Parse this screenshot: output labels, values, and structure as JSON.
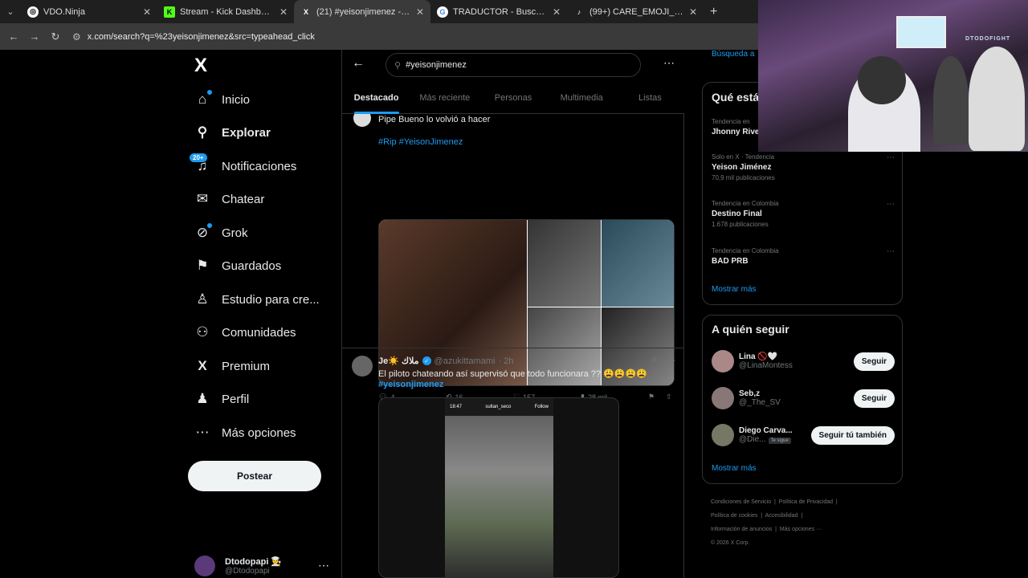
{
  "browser": {
    "tabs": [
      {
        "title": "VDO.Ninja",
        "fav_color": "#ffffff",
        "fav_text": "◎"
      },
      {
        "title": "Stream - Kick Dashboard",
        "fav_color": "#53fc18",
        "fav_text": "K"
      },
      {
        "title": "(21) #yeisonjimenez - Buscar / X",
        "fav_color": "#000000",
        "fav_text": "X"
      },
      {
        "title": "TRADUCTOR - Buscar con Goog",
        "fav_color": "#ffffff",
        "fav_text": "G"
      },
      {
        "title": "(99+) CARE_EMOJI_CLIPS. (@car",
        "fav_color": "#000000",
        "fav_text": "♪"
      }
    ],
    "url": "x.com/search?q=%23yeisonjimenez&src=typeahead_click"
  },
  "nav": {
    "logo": "X",
    "items": [
      {
        "label": "Inicio",
        "icon": "home-icon",
        "glyph": "⌂"
      },
      {
        "label": "Explorar",
        "icon": "search-icon",
        "glyph": "⚲"
      },
      {
        "label": "Notificaciones",
        "icon": "bell-icon",
        "glyph": "🔔"
      },
      {
        "label": "Chatear",
        "icon": "mail-icon",
        "glyph": "✉"
      },
      {
        "label": "Grok",
        "icon": "grok-icon",
        "glyph": "⊘"
      },
      {
        "label": "Guardados",
        "icon": "bookmark-icon",
        "glyph": "⚑"
      },
      {
        "label": "Estudio para cre...",
        "icon": "studio-icon",
        "glyph": "♙"
      },
      {
        "label": "Comunidades",
        "icon": "communities-icon",
        "glyph": "⚇"
      },
      {
        "label": "Premium",
        "icon": "premium-icon",
        "glyph": "X"
      },
      {
        "label": "Perfil",
        "icon": "profile-icon",
        "glyph": "♟"
      },
      {
        "label": "Más opciones",
        "icon": "more-icon",
        "glyph": "⋯"
      }
    ],
    "notif_badge": "20+",
    "post_label": "Postear",
    "account_name": "Dtodopapi 👨‍🍳",
    "account_handle": "@Dtodopapi"
  },
  "search": {
    "query": "#yeisonjimenez",
    "tabs": [
      "Destacado",
      "Más reciente",
      "Personas",
      "Multimedia",
      "Listas"
    ]
  },
  "post1": {
    "text": "Pipe Bueno lo volvió a hacer",
    "hashtags": "#Rip #YeisonJimenez",
    "replies": "4",
    "reposts": "16",
    "likes": "157",
    "views": "28 mil"
  },
  "post2": {
    "name": "Je☀️ ملاك",
    "handle": "@azukittamami",
    "time": "· 2h",
    "text": "El piloto chateando así supervisó que todo funcionara ?? 😩😩😩😩",
    "hashtag": "#yeisonjimenez",
    "video_time": "18:47",
    "video_user": "sultan_seco",
    "video_follow": "Follow"
  },
  "right": {
    "search_frag": "Búsqueda a",
    "trends_title": "Qué está",
    "trends": [
      {
        "context": "Tendencia en",
        "name": "Jhonny Rive",
        "posts": ""
      },
      {
        "context": "Solo en X · Tendencia",
        "name": "Yeison Jiménez",
        "posts": "70,9 mil publicaciones"
      },
      {
        "context": "Tendencia en Colombia",
        "name": "Destino Final",
        "posts": "1.678 publicaciones"
      },
      {
        "context": "Tendencia en Colombia",
        "name": "BAD PRB",
        "posts": ""
      }
    ],
    "show_more": "Mostrar más",
    "follow_title": "A quién seguir",
    "follows": [
      {
        "name": "Lina 🚫🤍",
        "handle": "@LinaMontess",
        "button": "Seguir",
        "tag": ""
      },
      {
        "name": "Seb,z",
        "handle": "@_The_SV",
        "button": "Seguir",
        "tag": ""
      },
      {
        "name": "Diego Carva...",
        "handle": "@Die...",
        "button": "Seguir tú también",
        "tag": "Te sigue"
      }
    ],
    "footer": [
      "Condiciones de Servicio",
      "Política de Privacidad",
      "Política de cookies",
      "Accesibilidad",
      "Información de anuncios",
      "Más opciones ···",
      "© 2026 X Corp."
    ]
  },
  "webcam": {
    "sign": "DTODOFIGHT"
  },
  "colors": {
    "accent": "#1d9bf0",
    "bg": "#000000",
    "border": "#2f3336"
  }
}
